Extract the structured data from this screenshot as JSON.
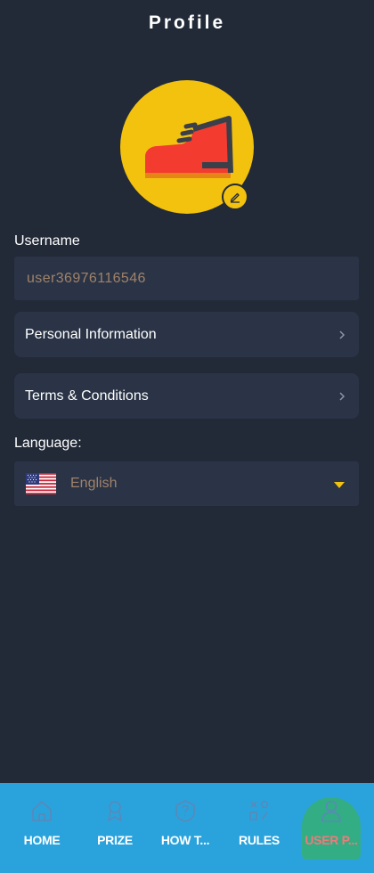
{
  "header": {
    "title": "Profile"
  },
  "avatar": {
    "icon": "boot-icon",
    "badge_icon": "pencil-icon",
    "bg_color": "#f3c20f",
    "boot_color": "#f33b30"
  },
  "username": {
    "label": "Username",
    "value": "user36976116546"
  },
  "menu": {
    "items": [
      {
        "label": "Personal Information",
        "icon": "chevron-right-icon"
      },
      {
        "label": "Terms & Conditions",
        "icon": "chevron-right-icon"
      }
    ]
  },
  "language": {
    "label": "Language:",
    "selected": "English",
    "flag": "us-flag-icon",
    "dropdown_icon": "caret-down-icon"
  },
  "bottom_nav": {
    "items": [
      {
        "label": "HOME",
        "icon": "home-icon"
      },
      {
        "label": "PRIZE",
        "icon": "trophy-icon"
      },
      {
        "label": "HOW T...",
        "icon": "help-icon"
      },
      {
        "label": "RULES",
        "icon": "rules-icon"
      },
      {
        "label": "USER P...",
        "icon": "user-icon",
        "active": true
      }
    ]
  },
  "colors": {
    "background": "#222a38",
    "card": "#2a3446",
    "accent": "#f3c20f",
    "nav_bg": "#2aa3dd",
    "nav_active": "#33ad84",
    "active_label": "#f07a7a",
    "muted_text": "#a0826a"
  }
}
